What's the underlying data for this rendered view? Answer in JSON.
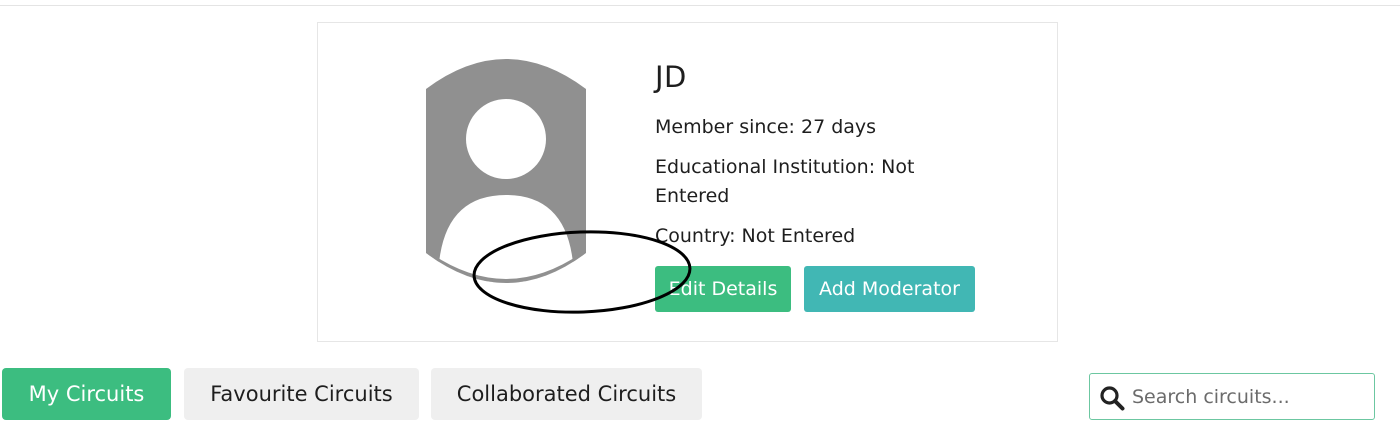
{
  "profile": {
    "name": "JD",
    "member_since": "Member since: 27 days",
    "institution": "Educational Institution: Not Entered",
    "country": "Country: Not Entered",
    "avatar_icon": "default-user-avatar",
    "edit_button": "Edit Details",
    "add_moderator_button": "Add Moderator"
  },
  "tabs": [
    {
      "label": "My Circuits",
      "active": true
    },
    {
      "label": "Favourite Circuits",
      "active": false
    },
    {
      "label": "Collaborated Circuits",
      "active": false
    }
  ],
  "search": {
    "placeholder": "Search circuits...",
    "value": "",
    "icon": "search-icon"
  },
  "colors": {
    "primary_green": "#3cbd80",
    "teal": "#41b7b4",
    "avatar_gray": "#909090",
    "tab_gray": "#efefef",
    "annotation": "#000000"
  }
}
